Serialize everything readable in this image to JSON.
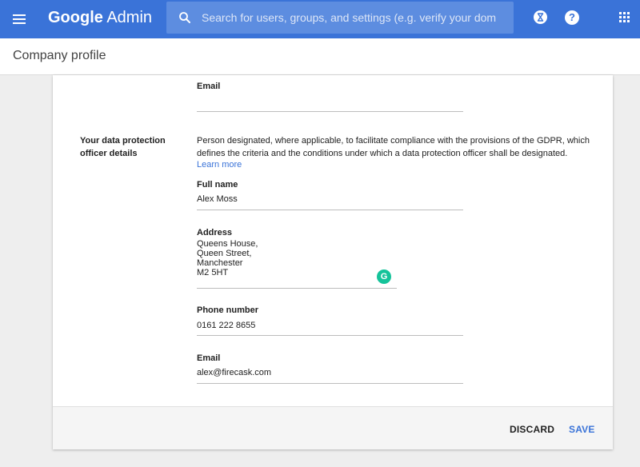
{
  "app": {
    "brand_google": "Google",
    "brand_admin": "Admin"
  },
  "search": {
    "placeholder": "Search for users, groups, and settings (e.g. verify your dom"
  },
  "header": {
    "title": "Company profile"
  },
  "top_email": {
    "label": "Email",
    "value": ""
  },
  "dpo": {
    "section_label": "Your data protection officer details",
    "description": "Person designated, where applicable, to facilitate compliance with the provisions of the GDPR, which defines the criteria and the conditions under which a data protection officer shall be designated.",
    "learn_more": "Learn more",
    "full_name": {
      "label": "Full name",
      "value": "Alex Moss"
    },
    "address": {
      "label": "Address",
      "lines": [
        "Queens House,",
        "Queen Street,",
        "Manchester",
        "M2 5HT"
      ]
    },
    "phone": {
      "label": "Phone number",
      "value": "0161 222 8655"
    },
    "email": {
      "label": "Email",
      "value": "alex@firecask.com"
    }
  },
  "footer": {
    "discard": "DISCARD",
    "save": "SAVE"
  },
  "help_icon_glyph": "?",
  "grammarly_glyph": "G",
  "colors": {
    "appbar": "#3a73d8",
    "accent": "#3a73d8",
    "grammarly": "#15c39a"
  }
}
